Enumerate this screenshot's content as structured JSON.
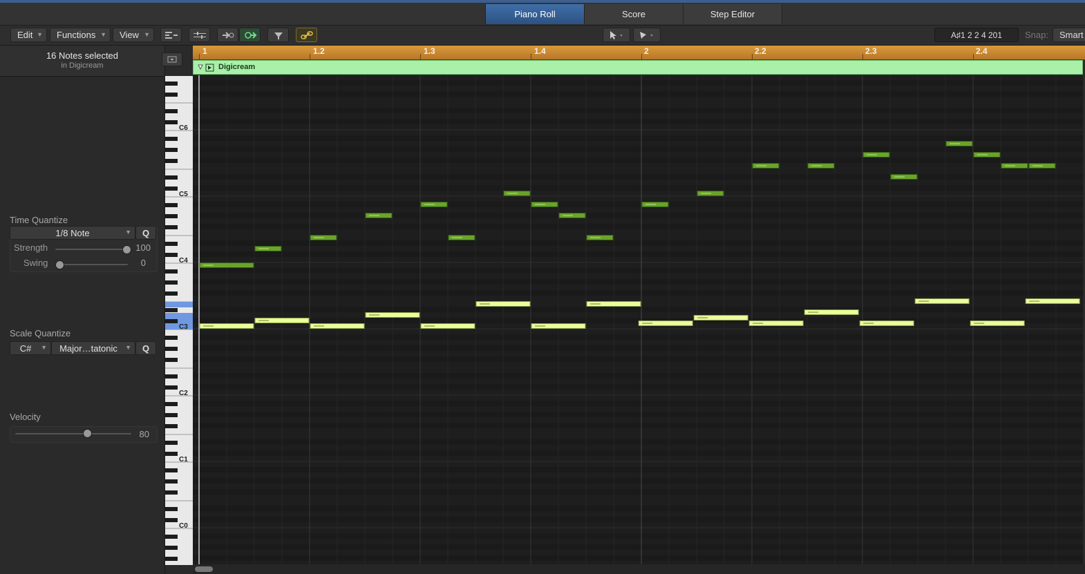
{
  "tabs": [
    {
      "label": "Piano Roll",
      "active": true
    },
    {
      "label": "Score",
      "active": false
    },
    {
      "label": "Step Editor",
      "active": false
    }
  ],
  "toolbar": {
    "edit_label": "Edit",
    "functions_label": "Functions",
    "view_label": "View",
    "position_display": "A♯1   2 2 4 201",
    "snap_label": "Snap:",
    "snap_value": "Smart"
  },
  "inspector": {
    "selection_title": "16 Notes selected",
    "selection_sub": "in Digicream",
    "time_quantize": {
      "label": "Time Quantize",
      "value": "1/8 Note",
      "q_label": "Q",
      "strength_label": "Strength",
      "strength_value": "100",
      "swing_label": "Swing",
      "swing_value": "0"
    },
    "scale_quantize": {
      "label": "Scale Quantize",
      "root": "C#",
      "scale": "Major…tatonic",
      "q_label": "Q"
    },
    "velocity": {
      "label": "Velocity",
      "value": "80"
    }
  },
  "keyboard_labels": [
    "C6",
    "C5",
    "C4",
    "C3",
    "C2",
    "C1",
    "C0"
  ],
  "ruler": {
    "bars": [
      "1",
      "1.2",
      "1.3",
      "1.4",
      "2",
      "2.2",
      "2.3",
      "2.4"
    ]
  },
  "region": {
    "name": "Digicream",
    "color": "#a9f0a9"
  },
  "note_colors": {
    "selected": "#e9ff9a",
    "unselected": "#6aa32a"
  },
  "notes": [
    {
      "beat": 0.0,
      "pitch": 47,
      "len": 0.5,
      "sel": false
    },
    {
      "beat": 0.5,
      "pitch": 50,
      "len": 0.25,
      "sel": false
    },
    {
      "beat": 1.0,
      "pitch": 52,
      "len": 0.25,
      "sel": false
    },
    {
      "beat": 1.5,
      "pitch": 56,
      "len": 0.25,
      "sel": false
    },
    {
      "beat": 2.0,
      "pitch": 58,
      "len": 0.25,
      "sel": false
    },
    {
      "beat": 2.25,
      "pitch": 52,
      "len": 0.25,
      "sel": false
    },
    {
      "beat": 2.75,
      "pitch": 60,
      "len": 0.25,
      "sel": false
    },
    {
      "beat": 3.0,
      "pitch": 58,
      "len": 0.25,
      "sel": false
    },
    {
      "beat": 3.25,
      "pitch": 56,
      "len": 0.25,
      "sel": false
    },
    {
      "beat": 3.5,
      "pitch": 52,
      "len": 0.25,
      "sel": false
    },
    {
      "beat": 4.0,
      "pitch": 58,
      "len": 0.25,
      "sel": false
    },
    {
      "beat": 4.5,
      "pitch": 60,
      "len": 0.25,
      "sel": false
    },
    {
      "beat": 5.0,
      "pitch": 65,
      "len": 0.25,
      "sel": false
    },
    {
      "beat": 5.5,
      "pitch": 65,
      "len": 0.25,
      "sel": false
    },
    {
      "beat": 6.0,
      "pitch": 67,
      "len": 0.25,
      "sel": false
    },
    {
      "beat": 6.25,
      "pitch": 63,
      "len": 0.25,
      "sel": false
    },
    {
      "beat": 6.75,
      "pitch": 69,
      "len": 0.25,
      "sel": false
    },
    {
      "beat": 7.0,
      "pitch": 67,
      "len": 0.25,
      "sel": false
    },
    {
      "beat": 7.25,
      "pitch": 65,
      "len": 0.25,
      "sel": false
    },
    {
      "beat": 7.5,
      "pitch": 65,
      "len": 0.25,
      "sel": false
    },
    {
      "beat": 0.0,
      "pitch": 36,
      "len": 0.5,
      "sel": true
    },
    {
      "beat": 0.5,
      "pitch": 37,
      "len": 0.5,
      "sel": true
    },
    {
      "beat": 1.0,
      "pitch": 36,
      "len": 0.5,
      "sel": true
    },
    {
      "beat": 1.5,
      "pitch": 38,
      "len": 0.5,
      "sel": true
    },
    {
      "beat": 2.0,
      "pitch": 36,
      "len": 0.5,
      "sel": true
    },
    {
      "beat": 2.5,
      "pitch": 40,
      "len": 0.5,
      "sel": true
    },
    {
      "beat": 3.0,
      "pitch": 36,
      "len": 0.5,
      "sel": true
    },
    {
      "beat": 3.5,
      "pitch": 40,
      "len": 0.5,
      "sel": true
    },
    {
      "beat": 3.97,
      "pitch": 36.5,
      "len": 0.5,
      "sel": true
    },
    {
      "beat": 4.47,
      "pitch": 37.5,
      "len": 0.5,
      "sel": true
    },
    {
      "beat": 4.97,
      "pitch": 36.5,
      "len": 0.5,
      "sel": true
    },
    {
      "beat": 5.47,
      "pitch": 38.5,
      "len": 0.5,
      "sel": true
    },
    {
      "beat": 5.97,
      "pitch": 36.5,
      "len": 0.5,
      "sel": true
    },
    {
      "beat": 6.47,
      "pitch": 40.5,
      "len": 0.5,
      "sel": true
    },
    {
      "beat": 6.97,
      "pitch": 36.5,
      "len": 0.5,
      "sel": true
    },
    {
      "beat": 7.47,
      "pitch": 40.5,
      "len": 0.5,
      "sel": true
    }
  ]
}
